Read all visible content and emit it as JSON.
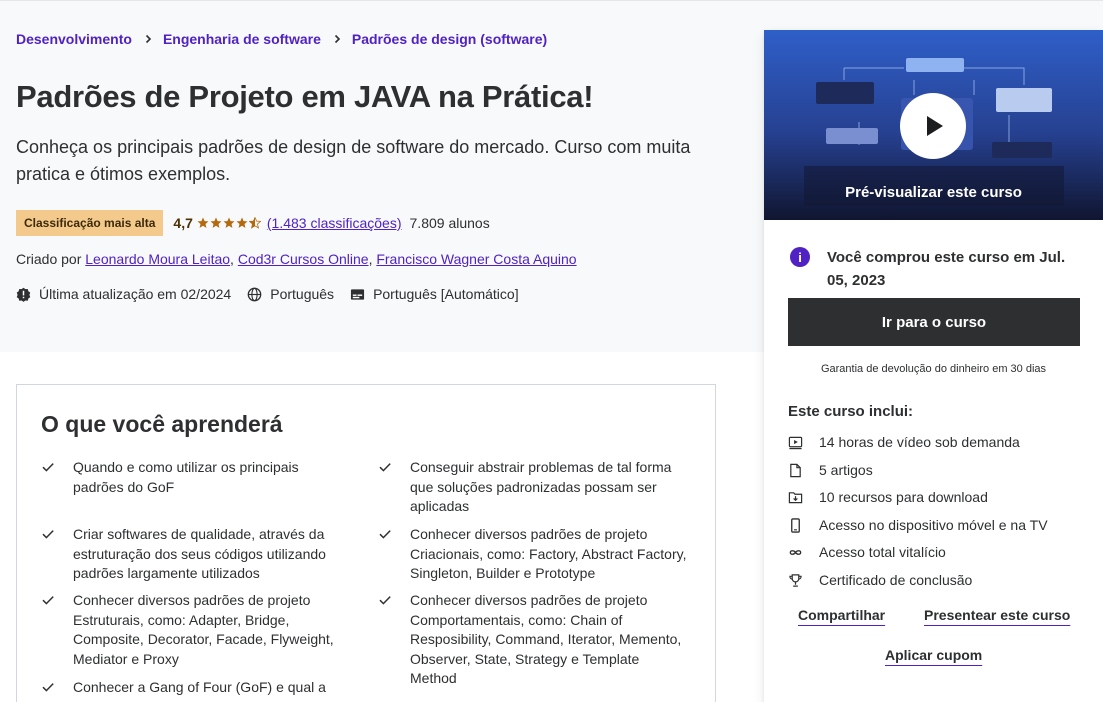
{
  "breadcrumb": {
    "items": [
      "Desenvolvimento",
      "Engenharia de software",
      "Padrões de design (software)"
    ]
  },
  "course": {
    "title": "Padrões de Projeto em JAVA na Prática!",
    "subtitle": "Conheça os principais padrões de design de software do mercado. Curso com muita pratica e ótimos exemplos.",
    "badge": "Classificação mais alta",
    "rating": "4,7",
    "rating_value": 4.7,
    "rating_count": "(1.483 classificações)",
    "students": "7.809 alunos",
    "created_by_label": "Criado por",
    "instructors": [
      "Leonardo Moura Leitao",
      "Cod3r Cursos Online",
      "Francisco Wagner Costa Aquino"
    ],
    "last_update": "Última atualização em 02/2024",
    "language": "Português",
    "captions": "Português [Automático]"
  },
  "learn": {
    "title": "O que você aprenderá",
    "items": [
      "Quando e como utilizar os principais padrões do GoF",
      "Conseguir abstrair problemas de tal forma que soluções padronizadas possam ser aplicadas",
      "Criar softwares de qualidade, através da estruturação dos seus códigos utilizando padrões largamente utilizados",
      "Conhecer diversos padrões de projeto Criacionais, como: Factory, Abstract Factory, Singleton, Builder e Prototype",
      "Conhecer diversos padrões de projeto Estruturais, como: Adapter, Bridge, Composite, Decorator, Facade, Flyweight, Mediator e Proxy",
      "Conhecer diversos padrões de projeto Comportamentais, como: Chain of Resposibility, Command, Iterator, Memento, Observer, State, Strategy e Template Method",
      "Conhecer a Gang of Four (GoF) e qual a sua"
    ]
  },
  "sidebar": {
    "preview_label": "Pré-visualizar este curso",
    "purchased": "Você comprou este curso em Jul. 05, 2023",
    "go_button": "Ir para o curso",
    "guarantee": "Garantia de devolução do dinheiro em 30 dias",
    "includes_title": "Este curso inclui:",
    "includes": [
      {
        "icon": "video-icon",
        "label": "14 horas de vídeo sob demanda"
      },
      {
        "icon": "file-icon",
        "label": "5 artigos"
      },
      {
        "icon": "download-icon",
        "label": "10 recursos para download"
      },
      {
        "icon": "mobile-icon",
        "label": "Acesso no dispositivo móvel e na TV"
      },
      {
        "icon": "infinity-icon",
        "label": "Acesso total vitalício"
      },
      {
        "icon": "trophy-icon",
        "label": "Certificado de conclusão"
      }
    ],
    "share": "Compartilhar",
    "gift": "Presentear este curso",
    "coupon": "Aplicar cupom"
  },
  "colors": {
    "link_purple": "#5022c3",
    "dark": "#2d2f31",
    "badge_bg": "#f3ca8c",
    "star": "#b4690e"
  }
}
